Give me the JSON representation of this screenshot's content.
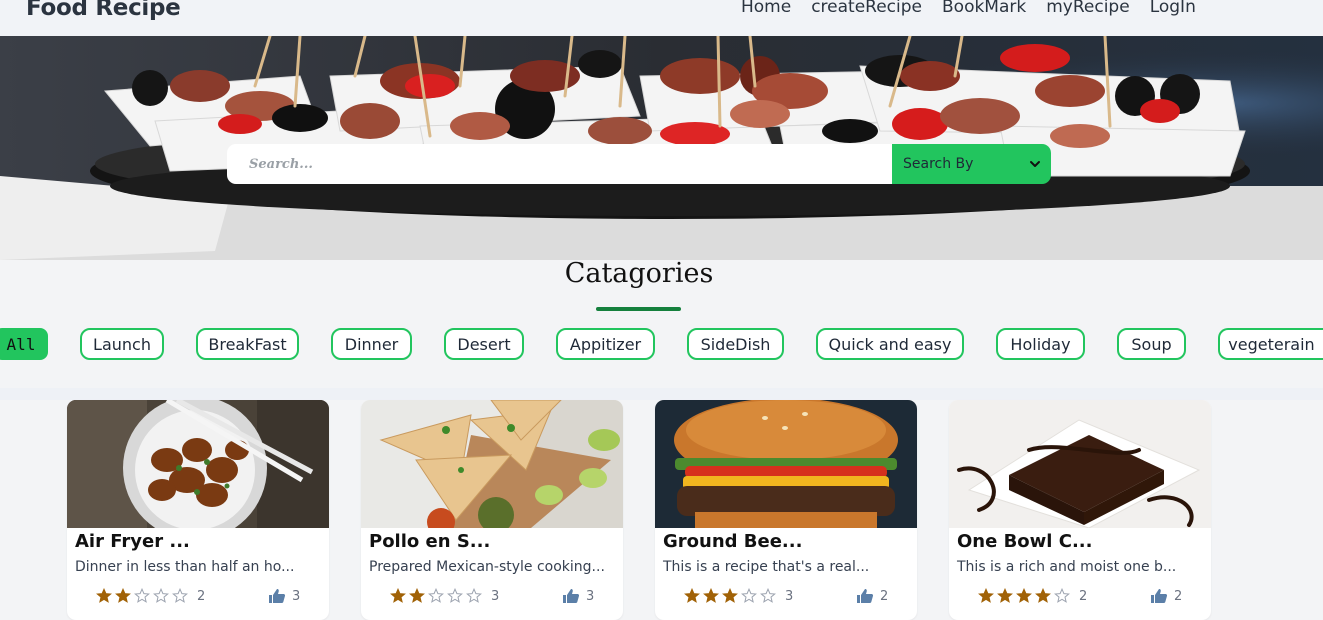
{
  "navbar": {
    "brand": "Food Recipe",
    "links": [
      "Home",
      "createRecipe",
      "BookMark",
      "myRecipe",
      "LogIn"
    ]
  },
  "search": {
    "placeholder": "Search...",
    "select_label": "Search By"
  },
  "categories": {
    "title": "Catagories",
    "items": [
      "All",
      "Launch",
      "BreakFast",
      "Dinner",
      "Desert",
      "Appitizer",
      "SideDish",
      "Quick and easy",
      "Holiday",
      "Soup",
      "vegeterain"
    ],
    "active": "All"
  },
  "recipes": [
    {
      "title": "Air Fryer ...",
      "description": "Dinner in less than half an ho...",
      "rating": 2,
      "rating_label": "2",
      "likes": "3",
      "image": "chicken-bowl"
    },
    {
      "title": "Pollo en S...",
      "description": "Prepared Mexican-style cooking...",
      "rating": 2,
      "rating_label": "3",
      "likes": "3",
      "image": "quesadilla"
    },
    {
      "title": "Ground Bee...",
      "description": "This is a recipe that's a real...",
      "rating": 3,
      "rating_label": "3",
      "likes": "2",
      "image": "burger"
    },
    {
      "title": "One Bowl C...",
      "description": "This is a rich and moist one b...",
      "rating": 4,
      "rating_label": "2",
      "likes": "2",
      "image": "brownie"
    }
  ],
  "colors": {
    "accent_green": "#22c55e",
    "underline_green": "#15803d",
    "star_gold": "#a16207",
    "thumb_blue": "#5b7fa8"
  }
}
